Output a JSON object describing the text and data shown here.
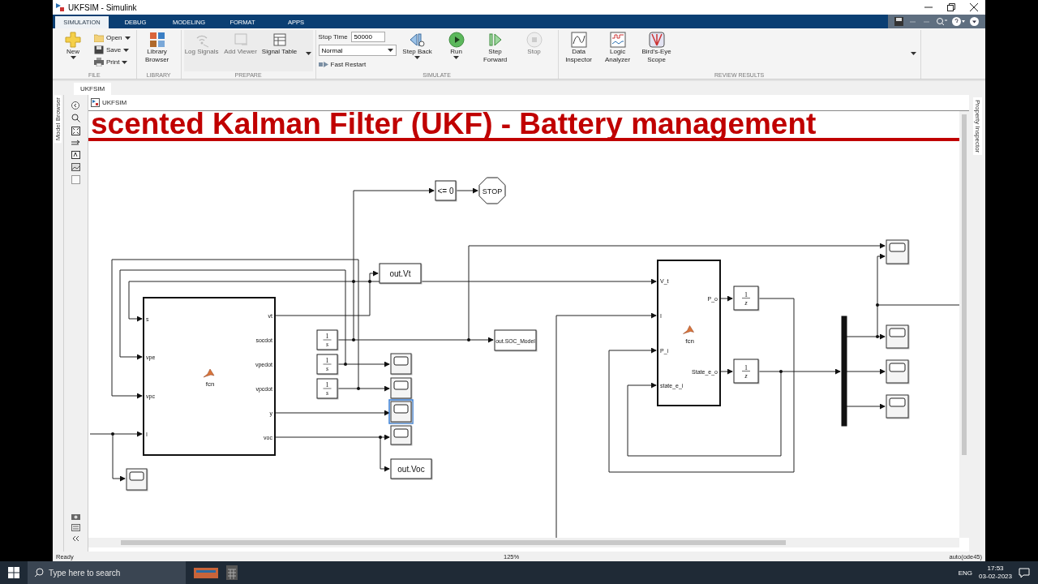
{
  "window": {
    "title": "UKFSIM - Simulink"
  },
  "ribbon_tabs": [
    {
      "label": "SIMULATION",
      "selected": true
    },
    {
      "label": "DEBUG",
      "selected": false
    },
    {
      "label": "MODELING",
      "selected": false
    },
    {
      "label": "FORMAT",
      "selected": false
    },
    {
      "label": "APPS",
      "selected": false
    }
  ],
  "ribbon_groups": [
    {
      "title": "FILE",
      "items": [
        {
          "kind": "new",
          "label": "New",
          "disabled": false
        },
        {
          "kind": "open",
          "label": "Open",
          "disabled": false
        },
        {
          "kind": "save",
          "label": "Save",
          "disabled": false
        },
        {
          "kind": "print",
          "label": "Print",
          "disabled": false
        }
      ]
    },
    {
      "title": "LIBRARY",
      "items": [
        {
          "kind": "library",
          "label": "Library Browser",
          "disabled": false
        }
      ]
    },
    {
      "title": "PREPARE",
      "items": [
        {
          "kind": "log",
          "label": "Log Signals",
          "disabled": true
        },
        {
          "kind": "viewer",
          "label": "Add Viewer",
          "disabled": true
        },
        {
          "kind": "table",
          "label": "Signal Table",
          "disabled": false
        }
      ]
    },
    {
      "title": "SIMULATE",
      "items": [
        {
          "kind": "stoptime",
          "label": "Stop Time",
          "value": "50000",
          "mode": "Normal",
          "restart": "Fast Restart"
        },
        {
          "kind": "stepback",
          "label": "Step Back",
          "disabled": false
        },
        {
          "kind": "run",
          "label": "Run",
          "disabled": false
        },
        {
          "kind": "stepfwd",
          "label": "Step Forward",
          "disabled": false
        },
        {
          "kind": "stop",
          "label": "Stop",
          "disabled": true
        }
      ]
    },
    {
      "title": "REVIEW RESULTS",
      "items": [
        {
          "kind": "inspector",
          "label": "Data Inspector",
          "disabled": false
        },
        {
          "kind": "logic",
          "label": "Logic Analyzer",
          "disabled": false
        },
        {
          "kind": "birdseye",
          "label": "Bird's-Eye Scope",
          "disabled": false
        }
      ]
    }
  ],
  "editor_tabs": [
    {
      "label": "UKFSIM",
      "selected": true
    }
  ],
  "breadcrumb": "UKFSIM",
  "side_panels": {
    "left": "Model Browser",
    "right": "Property Inspector"
  },
  "diagram": {
    "title": "scented Kalman Filter (UKF) - Battery management",
    "blocks": [
      {
        "kind": "compare",
        "label": "<= 0",
        "selected": false
      },
      {
        "kind": "stop",
        "label": "STOP",
        "selected": false
      },
      {
        "kind": "to_workspace",
        "label": "out.Vt",
        "selected": false
      },
      {
        "kind": "matlab_fn",
        "name": "fcn",
        "inputs": [
          "s",
          "vpe",
          "vpc",
          "I"
        ],
        "outputs": [
          "vt",
          "socdot",
          "vpedot",
          "vpcdot",
          "y",
          "voc"
        ],
        "selected": false
      },
      {
        "kind": "integrator",
        "numerator": "1",
        "denominator": "s",
        "selected": false
      },
      {
        "kind": "integrator",
        "numerator": "1",
        "denominator": "s",
        "selected": false
      },
      {
        "kind": "integrator",
        "numerator": "1",
        "denominator": "s",
        "selected": false
      },
      {
        "kind": "to_workspace",
        "label": "out.SOC_Model",
        "selected": false
      },
      {
        "kind": "scope",
        "selected": false
      },
      {
        "kind": "scope",
        "selected": false
      },
      {
        "kind": "scope",
        "selected": true
      },
      {
        "kind": "scope",
        "selected": false
      },
      {
        "kind": "to_workspace",
        "label": "out.Voc",
        "selected": false
      },
      {
        "kind": "scope",
        "selected": false
      },
      {
        "kind": "matlab_fn",
        "name": "fcn",
        "inputs": [
          "V_t",
          "I",
          "P_i",
          "state_e_i"
        ],
        "outputs": [
          "P_o",
          "State_e_o"
        ],
        "selected": false
      },
      {
        "kind": "delay",
        "numerator": "1",
        "denominator": "z",
        "selected": false
      },
      {
        "kind": "delay",
        "numerator": "1",
        "denominator": "z",
        "selected": false
      },
      {
        "kind": "mux",
        "selected": false
      },
      {
        "kind": "scope",
        "selected": false
      },
      {
        "kind": "scope",
        "selected": false
      },
      {
        "kind": "scope",
        "selected": false
      },
      {
        "kind": "scope",
        "selected": false
      }
    ]
  },
  "status_bar": {
    "state": "Ready",
    "zoom": "125%",
    "solver": "auto(ode45)"
  },
  "taskbar": {
    "search_placeholder": "Type here to search",
    "language": "ENG",
    "time": "17:53",
    "date": "03-02-2023"
  }
}
